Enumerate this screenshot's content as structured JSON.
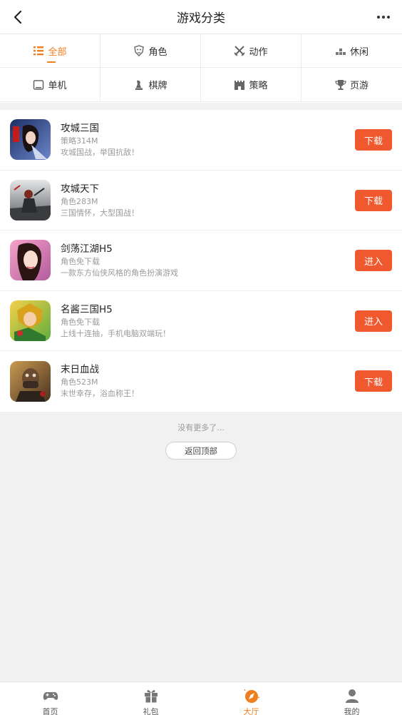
{
  "header": {
    "title": "游戏分类",
    "back_icon": "chevron-left-icon",
    "more_icon": "more-dots-icon"
  },
  "categories": [
    {
      "label": "全部",
      "icon": "list-icon",
      "active": true
    },
    {
      "label": "角色",
      "icon": "mask-icon"
    },
    {
      "label": "动作",
      "icon": "crossed-swords-icon"
    },
    {
      "label": "休闲",
      "icon": "blocks-icon"
    },
    {
      "label": "单机",
      "icon": "tablet-icon"
    },
    {
      "label": "棋牌",
      "icon": "chess-piece-icon"
    },
    {
      "label": "策略",
      "icon": "castle-icon"
    },
    {
      "label": "页游",
      "icon": "trophy-icon"
    }
  ],
  "games": [
    {
      "name": "攻城三国",
      "meta": "策略314M",
      "desc": "攻城国战，举国抗敌！",
      "action": "下载"
    },
    {
      "name": "攻城天下",
      "meta": "角色283M",
      "desc": "三国情怀，大型国战！",
      "action": "下载"
    },
    {
      "name": "剑荡江湖H5",
      "meta": "角色免下载",
      "desc": "一款东方仙侠风格的角色扮演游戏",
      "action": "进入"
    },
    {
      "name": "名酱三国H5",
      "meta": "角色免下载",
      "desc": "上线十连抽，手机电脑双端玩！",
      "action": "进入"
    },
    {
      "name": "末日血战",
      "meta": "角色523M",
      "desc": "末世幸存，浴血称王！",
      "action": "下载"
    }
  ],
  "footer": {
    "no_more": "没有更多了...",
    "back_to_top": "返回顶部"
  },
  "tabbar": [
    {
      "label": "首页",
      "icon": "gamepad-icon"
    },
    {
      "label": "礼包",
      "icon": "gift-icon"
    },
    {
      "label": "大厅",
      "icon": "compass-icon",
      "active": true
    },
    {
      "label": "我的",
      "icon": "user-icon"
    }
  ],
  "colors": {
    "accent": "#f07d1e",
    "button": "#f0582d",
    "background": "#f1f1f1"
  }
}
